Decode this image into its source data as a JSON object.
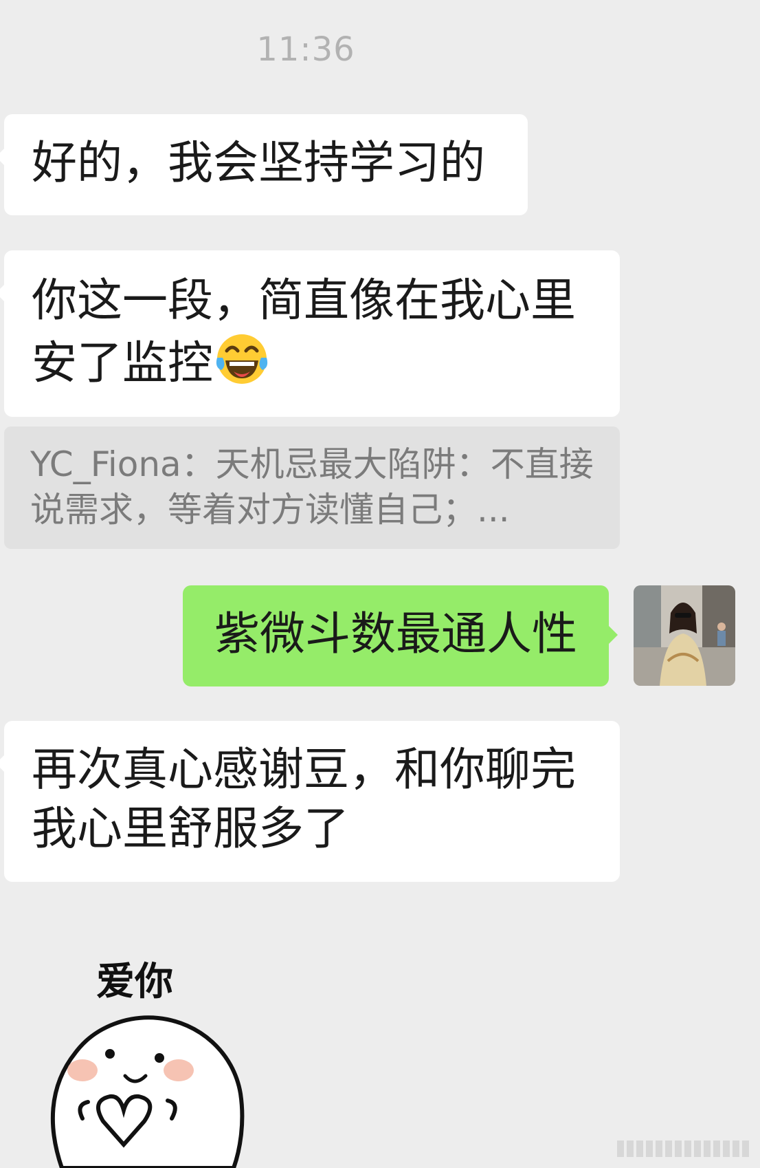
{
  "status": {
    "timestamp": "11:36"
  },
  "messages": {
    "m1": {
      "text": "好的，我会坚持学习的"
    },
    "m2": {
      "text": "你这一段，简直像在我心里安了监控",
      "emoji": "laughing-tears"
    },
    "quote": {
      "text": "YC_Fiona：天机忌最大陷阱：不直接说需求，等着对方读懂自己；..."
    },
    "m3": {
      "text": "紫微斗数最通人性"
    },
    "m4": {
      "text": "再次真心感谢豆，和你聊完我心里舒服多了"
    },
    "sticker": {
      "caption": "爱你"
    }
  },
  "colors": {
    "background": "#ededed",
    "incoming_bubble": "#ffffff",
    "outgoing_bubble": "#95ec69",
    "quote_bubble": "#e1e1e1",
    "timestamp": "#b2b2b2"
  },
  "icons": {
    "emoji": "laughing-tears-emoji-icon",
    "avatar": "user-avatar",
    "sticker": "love-you-sticker"
  }
}
